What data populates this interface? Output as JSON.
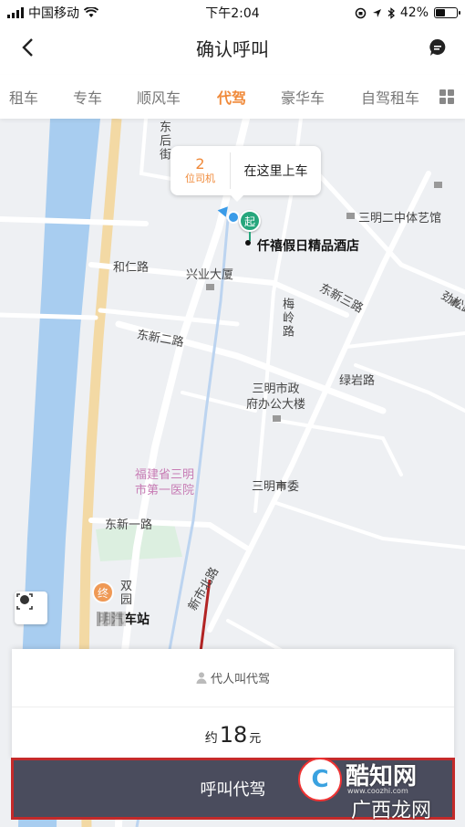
{
  "status": {
    "carrier": "中国移动",
    "time": "下午2:04",
    "battery": "42%"
  },
  "nav": {
    "title": "确认呼叫"
  },
  "tabs": [
    {
      "label": "租车"
    },
    {
      "label": "专车"
    },
    {
      "label": "顺风车"
    },
    {
      "label": "代驾"
    },
    {
      "label": "豪华车"
    },
    {
      "label": "自驾租车"
    }
  ],
  "bubble": {
    "count": "2",
    "unit": "位司机",
    "place": "在这里上车"
  },
  "map": {
    "labels": {
      "dongfang": "东后街",
      "heren": "和仁路",
      "xingye": "兴业大厦",
      "dongxin3": "东新三路",
      "meiling": "梅岭路",
      "dongxin2": "东新二路",
      "sanming2": "三明二中体艺馆",
      "jinsong": "劲松路",
      "lvyan": "绿岩路",
      "zhengfu": "三明市政\n府办公大楼",
      "hospital": "福建省三明\n市第一医院",
      "shiwei": "三明市委",
      "dongxin1": "东新一路",
      "xinshibei": "新市北路",
      "shuang": "双\n园"
    },
    "start_name": "仟禧假日精品酒店",
    "start_marker": "起",
    "end_marker": "终",
    "end_name": "明汽车站"
  },
  "panel": {
    "proxy": "代人叫代驾",
    "price_prefix": "约",
    "price_amount": "18",
    "price_unit": "元"
  },
  "call_button": "呼叫代驾",
  "watermark": {
    "logo": "C",
    "name": "酷知网",
    "url": "www.coozhi.com",
    "sub": "广西龙网"
  },
  "colors": {
    "accent": "#f08a3a",
    "start_pin": "#26a67c",
    "river": "#a8cdf0",
    "button": "#4a4c5d",
    "highlight": "#c42a2a"
  }
}
